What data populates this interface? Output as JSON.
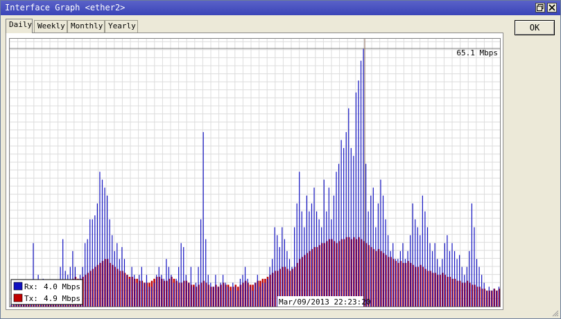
{
  "window": {
    "title": "Interface Graph <ether2>",
    "restore_icon": "restore-icon",
    "close_icon": "close-icon"
  },
  "tabs": [
    {
      "label": "Daily",
      "active": true
    },
    {
      "label": "Weekly",
      "active": false
    },
    {
      "label": "Monthly",
      "active": false
    },
    {
      "label": "Yearly",
      "active": false
    }
  ],
  "ok_label": "OK",
  "graph": {
    "max_label": "65.1 Mbps",
    "cursor_time": "Mar/09/2013 22:23:20",
    "legend": {
      "rx_label": "Rx:",
      "rx_value": "4.0 Mbps",
      "tx_label": "Tx:",
      "tx_value": "4.9 Mbps"
    },
    "colors": {
      "rx": "#1010c0",
      "tx": "#c00000",
      "cursor": "#8a6a5a"
    }
  },
  "chart_data": {
    "type": "bar",
    "ylabel": "",
    "xlabel": "",
    "ylim": [
      0,
      65.1
    ],
    "unit": "Mbps",
    "series": [
      {
        "name": "Rx",
        "values": [
          0.5,
          0.7,
          1.0,
          1.3,
          1.5,
          1.8,
          2.0,
          2.5,
          3.0,
          16.0,
          1.0,
          8.0,
          6.0,
          7.0,
          1.0,
          0.8,
          2.0,
          1.5,
          1.0,
          1.5,
          10.0,
          17.0,
          9.0,
          8.0,
          10.0,
          14.0,
          10.0,
          6.0,
          8.0,
          10.0,
          16.0,
          17.0,
          22.0,
          22.0,
          23.0,
          26.0,
          34.0,
          32.0,
          30.0,
          28.0,
          22.0,
          18.0,
          14.0,
          16.0,
          12.0,
          15.0,
          12.0,
          8.0,
          7.0,
          10.0,
          8.0,
          6.0,
          8.0,
          10.0,
          6.0,
          8.0,
          5.0,
          5.0,
          6.0,
          8.0,
          10.0,
          8.0,
          7.0,
          12.0,
          10.0,
          8.0,
          6.0,
          7.0,
          10.0,
          16.0,
          15.0,
          8.0,
          6.0,
          10.0,
          5.0,
          6.0,
          10.0,
          22.0,
          44.0,
          17.0,
          8.0,
          6.0,
          5.0,
          8.0,
          5.0,
          6.0,
          8.0,
          6.0,
          5.0,
          4.0,
          6.0,
          5.0,
          4.0,
          7.0,
          8.0,
          10.0,
          7.0,
          5.0,
          4.0,
          6.0,
          8.0,
          5.0,
          6.0,
          6.0,
          7.0,
          10.0,
          12.0,
          20.0,
          18.0,
          15.0,
          20.0,
          17.0,
          14.0,
          12.0,
          10.0,
          20.0,
          26.0,
          34.0,
          24.0,
          20.0,
          28.0,
          24.0,
          26.0,
          30.0,
          24.0,
          22.0,
          20.0,
          32.0,
          24.0,
          30.0,
          22.0,
          28.0,
          34.0,
          36.0,
          42.0,
          40.0,
          44.0,
          50.0,
          40.0,
          38.0,
          54.0,
          57.0,
          62.0,
          65.0,
          36.0,
          24.0,
          28.0,
          30.0,
          20.0,
          26.0,
          32.0,
          28.0,
          22.0,
          18.0,
          14.0,
          16.0,
          12.0,
          12.0,
          14.0,
          16.0,
          12.0,
          14.0,
          18.0,
          26.0,
          22.0,
          20.0,
          18.0,
          28.0,
          24.0,
          20.0,
          16.0,
          14.0,
          16.0,
          12.0,
          10.0,
          12.0,
          16.0,
          18.0,
          14.0,
          16.0,
          14.0,
          12.0,
          13.0,
          10.0,
          8.0,
          10.0,
          14.0,
          26.0,
          20.0,
          12.0,
          10.0,
          8.0,
          6.0,
          4.0,
          5.0,
          4.0,
          4.5,
          4.0,
          5.0
        ]
      },
      {
        "name": "Tx",
        "values": [
          0.3,
          0.4,
          0.5,
          0.6,
          0.7,
          0.8,
          1.0,
          1.2,
          1.5,
          2.0,
          1.0,
          1.5,
          1.5,
          2.0,
          1.0,
          0.5,
          1.0,
          1.0,
          0.8,
          1.0,
          4.0,
          5.0,
          5.5,
          6.0,
          6.5,
          7.0,
          7.5,
          7.0,
          7.0,
          7.5,
          8.0,
          8.5,
          9.0,
          9.5,
          10.0,
          10.5,
          11.0,
          11.5,
          12.0,
          12.0,
          11.0,
          10.5,
          10.0,
          9.5,
          9.0,
          9.0,
          8.5,
          8.0,
          7.5,
          7.5,
          7.0,
          7.0,
          6.5,
          6.5,
          6.0,
          6.0,
          6.0,
          6.5,
          7.0,
          7.5,
          7.5,
          7.0,
          6.5,
          6.5,
          7.0,
          7.5,
          7.0,
          6.5,
          6.0,
          6.0,
          6.5,
          6.5,
          6.0,
          5.5,
          5.5,
          5.0,
          5.5,
          6.0,
          6.5,
          6.0,
          5.5,
          5.0,
          5.0,
          5.5,
          5.0,
          5.5,
          6.0,
          5.5,
          5.5,
          5.0,
          5.0,
          5.5,
          5.0,
          5.5,
          6.0,
          6.5,
          6.0,
          5.5,
          5.5,
          6.0,
          6.5,
          6.5,
          7.0,
          7.0,
          7.5,
          8.0,
          8.5,
          9.0,
          9.0,
          9.5,
          10.0,
          10.0,
          9.5,
          9.0,
          9.5,
          10.0,
          11.0,
          12.0,
          12.5,
          13.0,
          13.5,
          14.0,
          14.5,
          15.0,
          15.0,
          15.5,
          16.0,
          16.0,
          16.5,
          17.0,
          17.0,
          16.5,
          16.0,
          16.5,
          17.0,
          17.0,
          17.5,
          17.5,
          17.0,
          17.5,
          17.0,
          17.5,
          17.0,
          16.5,
          16.0,
          15.5,
          15.0,
          14.5,
          14.0,
          14.5,
          14.0,
          13.5,
          13.0,
          12.5,
          12.5,
          12.0,
          11.5,
          11.0,
          11.5,
          11.0,
          11.0,
          11.5,
          11.0,
          10.5,
          10.0,
          10.0,
          10.5,
          10.0,
          9.5,
          9.0,
          9.0,
          8.5,
          8.5,
          8.0,
          8.0,
          8.5,
          8.0,
          7.5,
          7.5,
          7.0,
          7.0,
          6.5,
          6.5,
          6.0,
          6.0,
          6.5,
          6.0,
          5.5,
          5.5,
          5.0,
          5.0,
          4.5,
          4.5,
          4.0,
          4.0,
          4.0,
          4.5,
          4.0,
          4.5,
          4.5,
          4.5
        ]
      }
    ]
  }
}
